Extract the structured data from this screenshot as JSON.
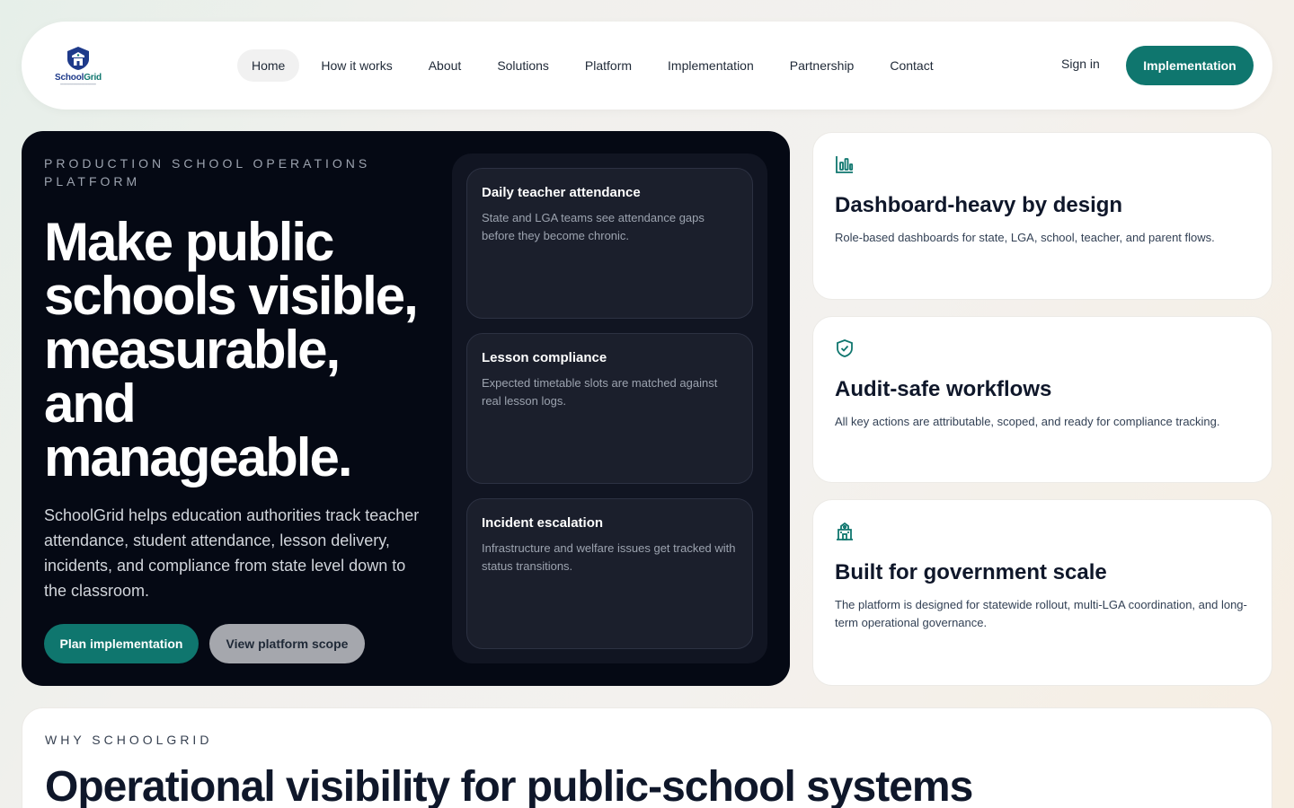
{
  "nav": {
    "logo_name": "SchoolGrid",
    "links": [
      "Home",
      "How it works",
      "About",
      "Solutions",
      "Platform",
      "Implementation",
      "Partnership",
      "Contact"
    ],
    "active": "Home",
    "signin": "Sign in",
    "cta": "Implementation"
  },
  "hero": {
    "eyebrow": "PRODUCTION SCHOOL OPERATIONS PLATFORM",
    "headline": "Make public schools visible, measurable, and manageable.",
    "description": "SchoolGrid helps education authorities track teacher attendance, student attendance, lesson delivery, incidents, and compliance from state level down to the classroom.",
    "primary_button": "Plan implementation",
    "secondary_button": "View platform scope",
    "cards": [
      {
        "title": "Daily teacher attendance",
        "desc": "State and LGA teams see attendance gaps before they become chronic."
      },
      {
        "title": "Lesson compliance",
        "desc": "Expected timetable slots are matched against real lesson logs."
      },
      {
        "title": "Incident escalation",
        "desc": "Infrastructure and welfare issues get tracked with status transitions."
      }
    ]
  },
  "features": [
    {
      "icon": "bar-chart-icon",
      "title": "Dashboard-heavy by design",
      "desc": "Role-based dashboards for state, LGA, school, teacher, and parent flows."
    },
    {
      "icon": "shield-check-icon",
      "title": "Audit-safe workflows",
      "desc": "All key actions are attributable, scoped, and ready for compliance tracking."
    },
    {
      "icon": "school-building-icon",
      "title": "Built for government scale",
      "desc": "The platform is designed for statewide rollout, multi-LGA coordination, and long-term operational governance."
    }
  ],
  "why": {
    "eyebrow": "WHY SCHOOLGRID",
    "title": "Operational visibility for public-school systems"
  },
  "colors": {
    "accent": "#0f766e",
    "hero_bg": "#050914",
    "panel_bg": "#111522"
  }
}
